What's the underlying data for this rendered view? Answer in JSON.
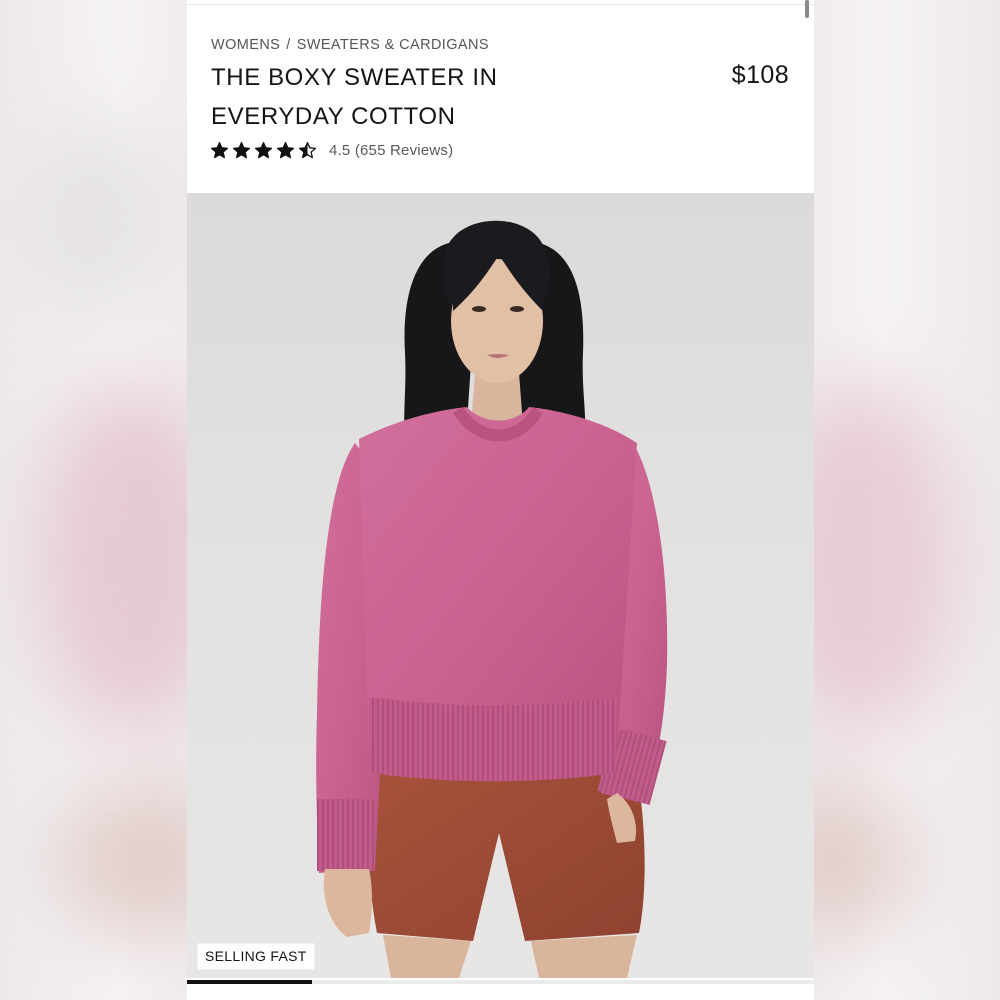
{
  "breadcrumb": {
    "category": "WOMENS",
    "separator": "/",
    "subcategory": "SWEATERS & CARDIGANS"
  },
  "product": {
    "title_line1": "THE BOXY SWEATER IN",
    "title_line2": "EVERYDAY COTTON",
    "price": "$108",
    "rating_value": 4.5,
    "rating_max": 5,
    "rating_text": "4.5 (655 Reviews)",
    "badge": "SELLING FAST",
    "image_alt": "Model wearing a pink boxy cotton sweater with rust shorts"
  },
  "gallery": {
    "progress_fraction": 0.2
  },
  "colors": {
    "text_primary": "#141414",
    "text_secondary": "#555555",
    "sweater_pink": "#c9618f",
    "shorts_rust": "#9e4a35",
    "progress": "#111111"
  },
  "icons": {
    "star_full": "star-icon",
    "star_half": "star-half-icon"
  }
}
